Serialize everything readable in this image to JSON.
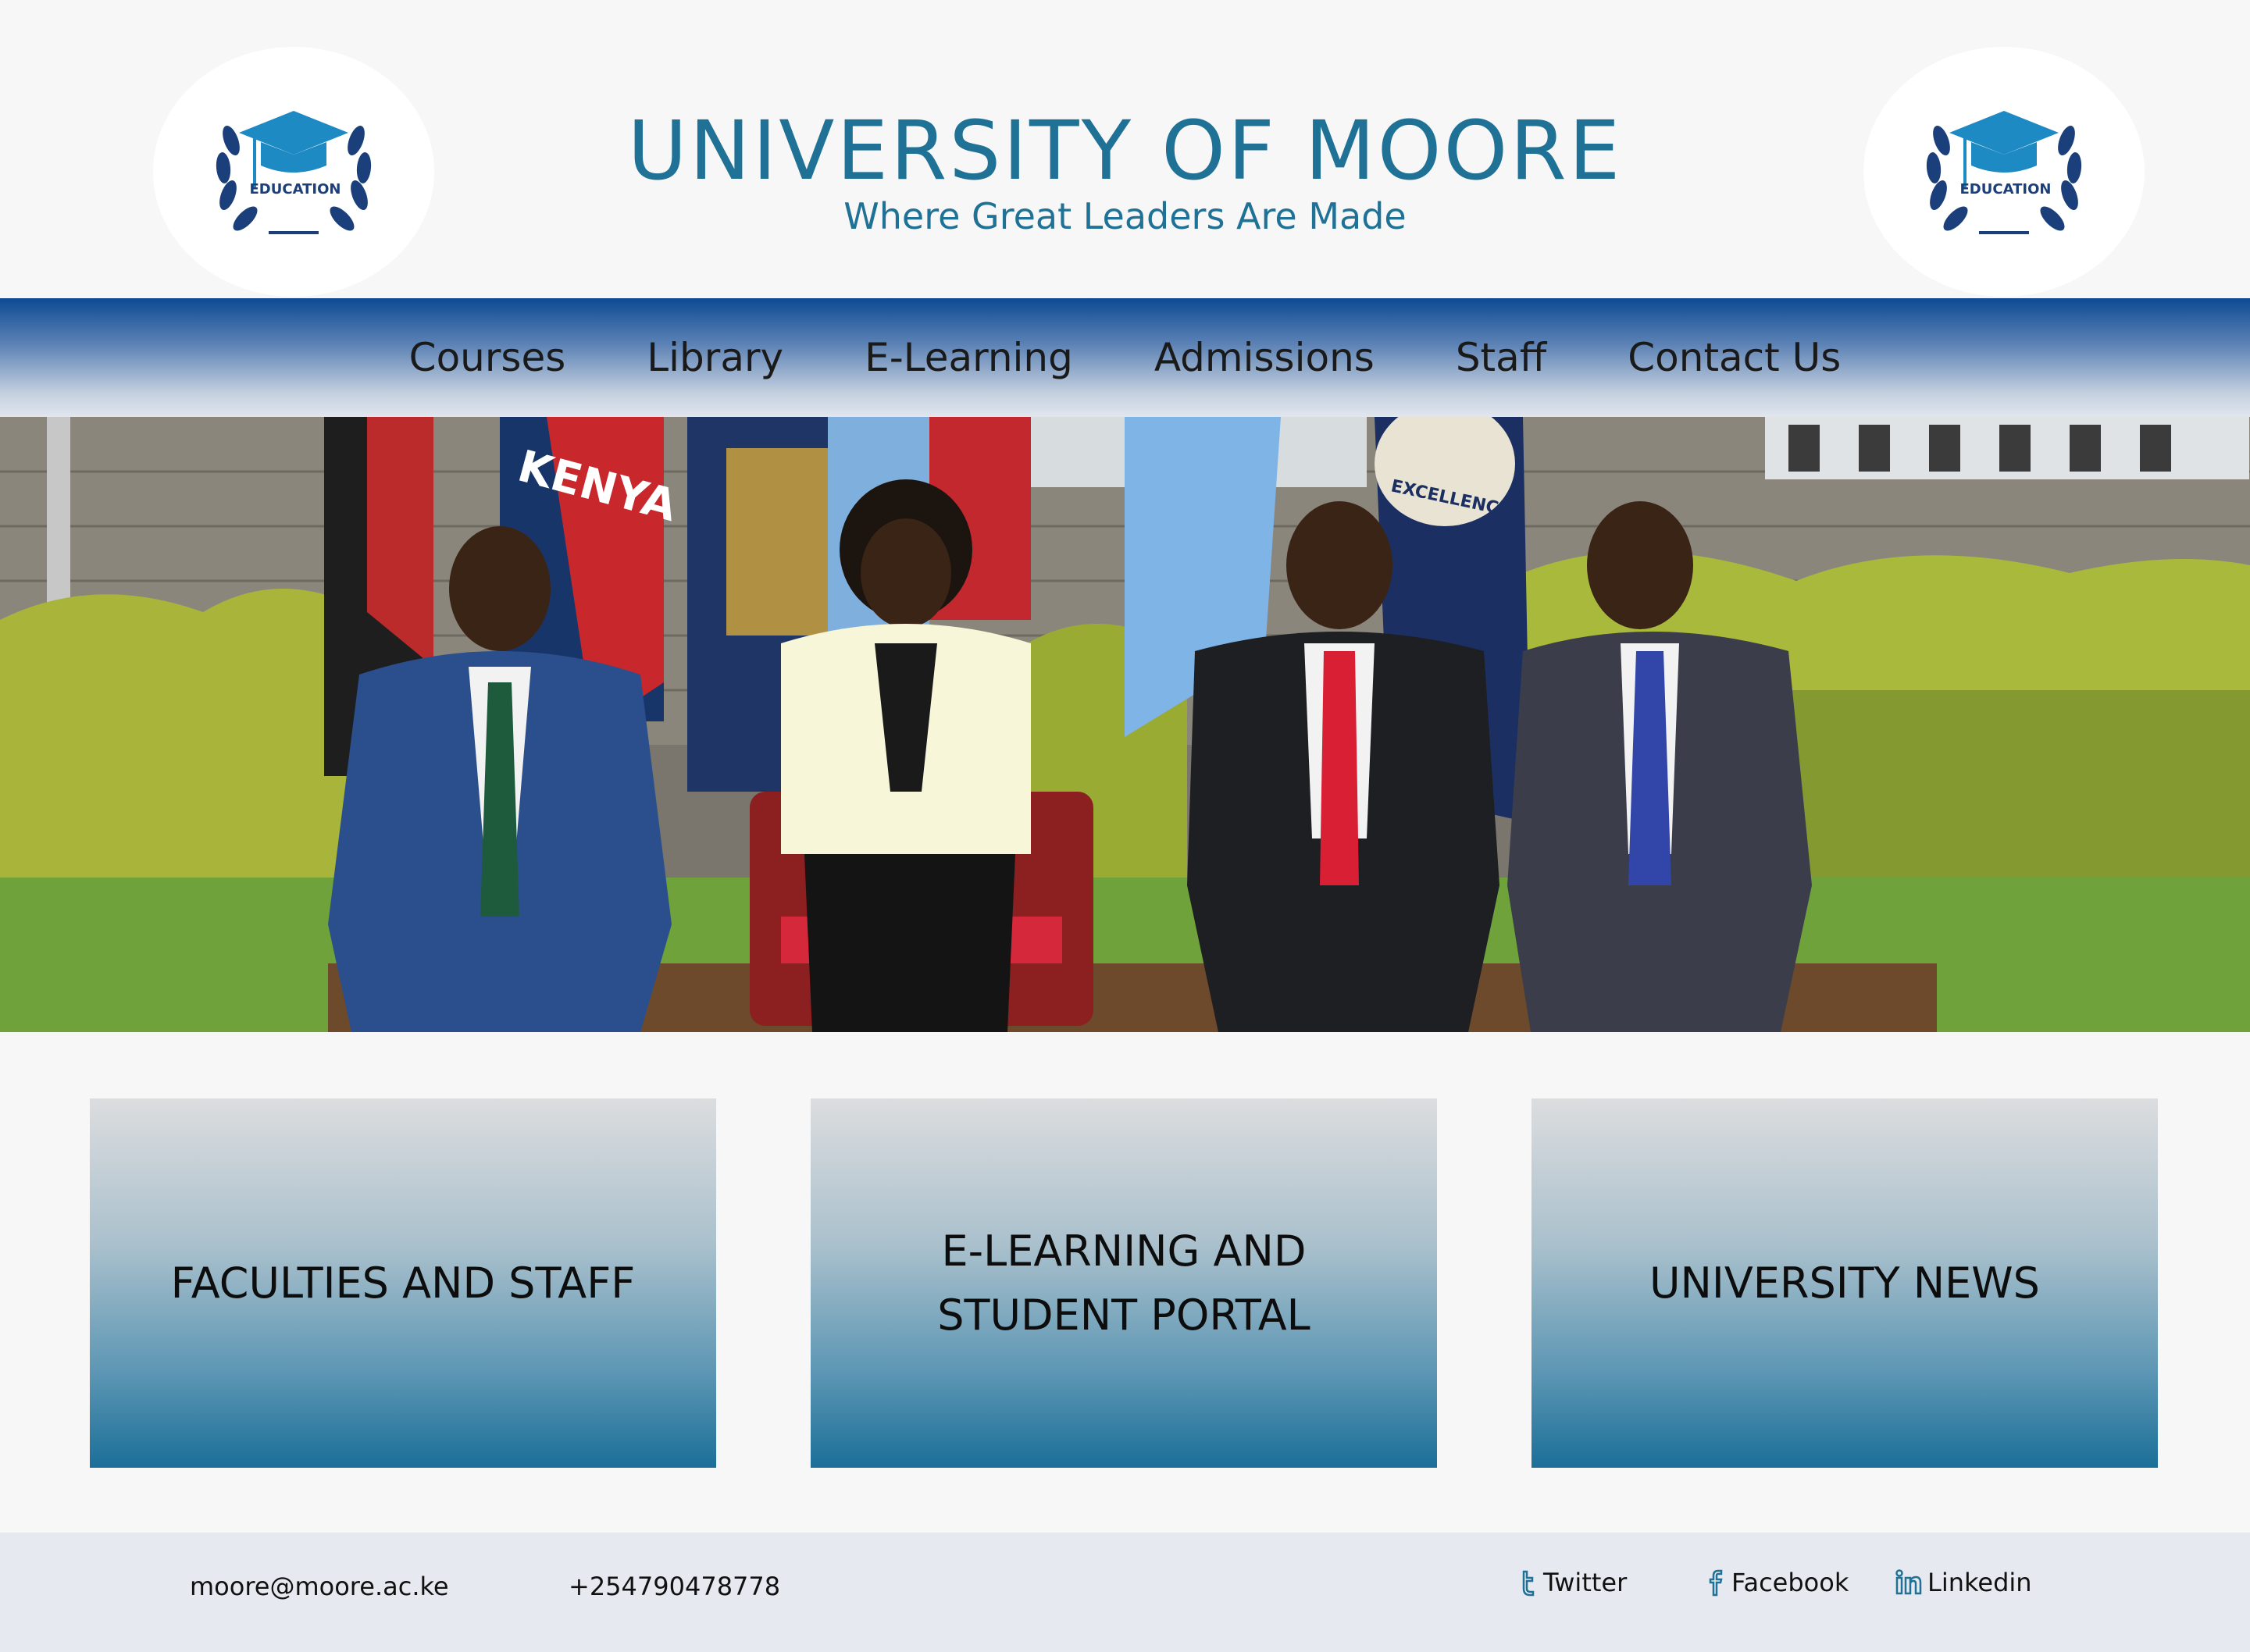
{
  "header": {
    "title": "UNIVERSITY OF MOORE",
    "subtitle": "Where Great Leaders Are Made",
    "logo_left_text": "EDUCATION",
    "logo_right_text": "EDUCATION",
    "logo_icon": "graduation-cap-laurel-icon"
  },
  "nav": {
    "items": [
      "Courses",
      "Library",
      "E-Learning",
      "Admissions",
      "Staff",
      "Contact Us"
    ]
  },
  "hero": {
    "flag_texts": [
      "KENYA",
      "EXCELLENCE"
    ]
  },
  "cards": [
    {
      "label": "FACULTIES AND STAFF"
    },
    {
      "label": "E-LEARNING AND STUDENT PORTAL"
    },
    {
      "label": "UNIVERSITY NEWS"
    }
  ],
  "footer": {
    "email": "moore@moore.ac.ke",
    "phone": "+254790478778",
    "social": [
      {
        "label": "Twitter",
        "icon": "twitter-icon"
      },
      {
        "label": "Facebook",
        "icon": "facebook-icon"
      },
      {
        "label": "Linkedin",
        "icon": "linkedin-icon"
      }
    ]
  },
  "colors": {
    "brand_blue": "#1f7196",
    "nav_top": "#0d4a93",
    "card_bottom": "#1b6f98",
    "footer_bg": "#e6e9ef"
  }
}
